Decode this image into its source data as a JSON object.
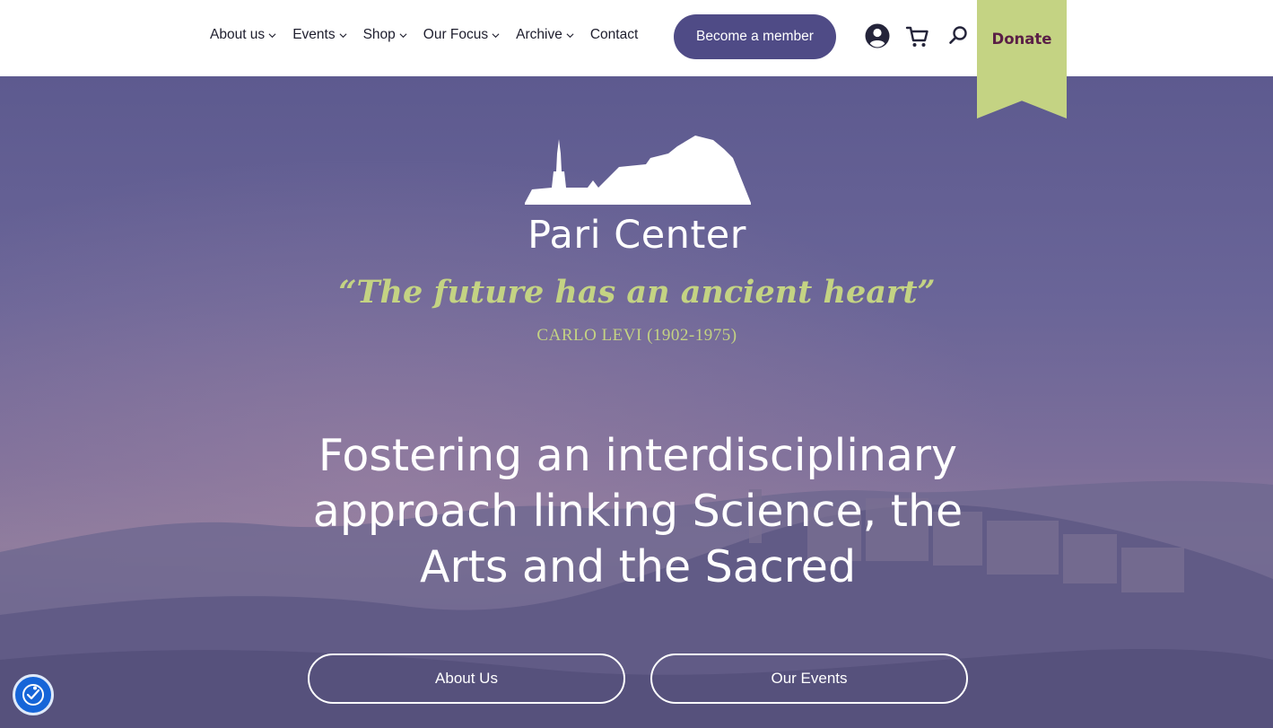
{
  "nav": {
    "items": [
      {
        "label": "About us",
        "has_dropdown": true
      },
      {
        "label": "Events",
        "has_dropdown": true
      },
      {
        "label": "Shop",
        "has_dropdown": true
      },
      {
        "label": "Our Focus",
        "has_dropdown": true
      },
      {
        "label": "Archive",
        "has_dropdown": true
      }
    ],
    "contact_label": "Contact",
    "member_button": "Become a member",
    "donate_label": "Donate"
  },
  "header_icons": [
    "account-icon",
    "cart-icon",
    "search-icon"
  ],
  "hero": {
    "logo_text": "Pari Center",
    "quote": "“The future has an ancient heart”",
    "quote_author": "CARLO LEVI (1902-1975)",
    "headline_lines": [
      "Fostering an interdisciplinary",
      "approach linking Science, the",
      "Arts and the Sacred"
    ],
    "buttons": {
      "about": "About Us",
      "events": "Our Events"
    }
  },
  "colors": {
    "accent_purple": "#4f4b86",
    "donate_green": "#c4d383",
    "donate_text": "#5a1f46",
    "quote_green": "#c4d383",
    "accessibility_blue": "#1665d8"
  }
}
